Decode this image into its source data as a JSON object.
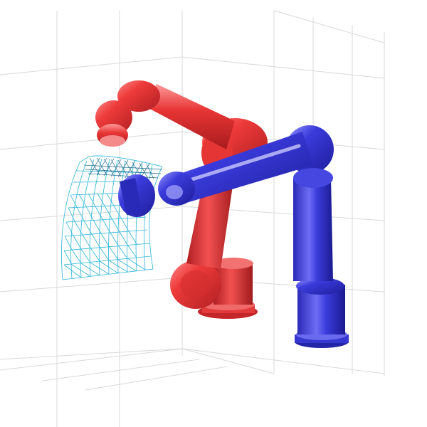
{
  "scene": {
    "colors": {
      "background": "#ffffff",
      "grid": "#d9d9d9",
      "robot_a": "#e8333a",
      "robot_b": "#3b3bdc",
      "mesh": "#2bb5d8"
    },
    "objects": [
      {
        "name": "room-grid",
        "type": "wireframe-box"
      },
      {
        "name": "red-robot-arm",
        "type": "six-axis-manipulator"
      },
      {
        "name": "blue-robot-arm",
        "type": "six-axis-manipulator"
      },
      {
        "name": "surface-mesh",
        "type": "curved-wireframe-patch"
      }
    ]
  }
}
